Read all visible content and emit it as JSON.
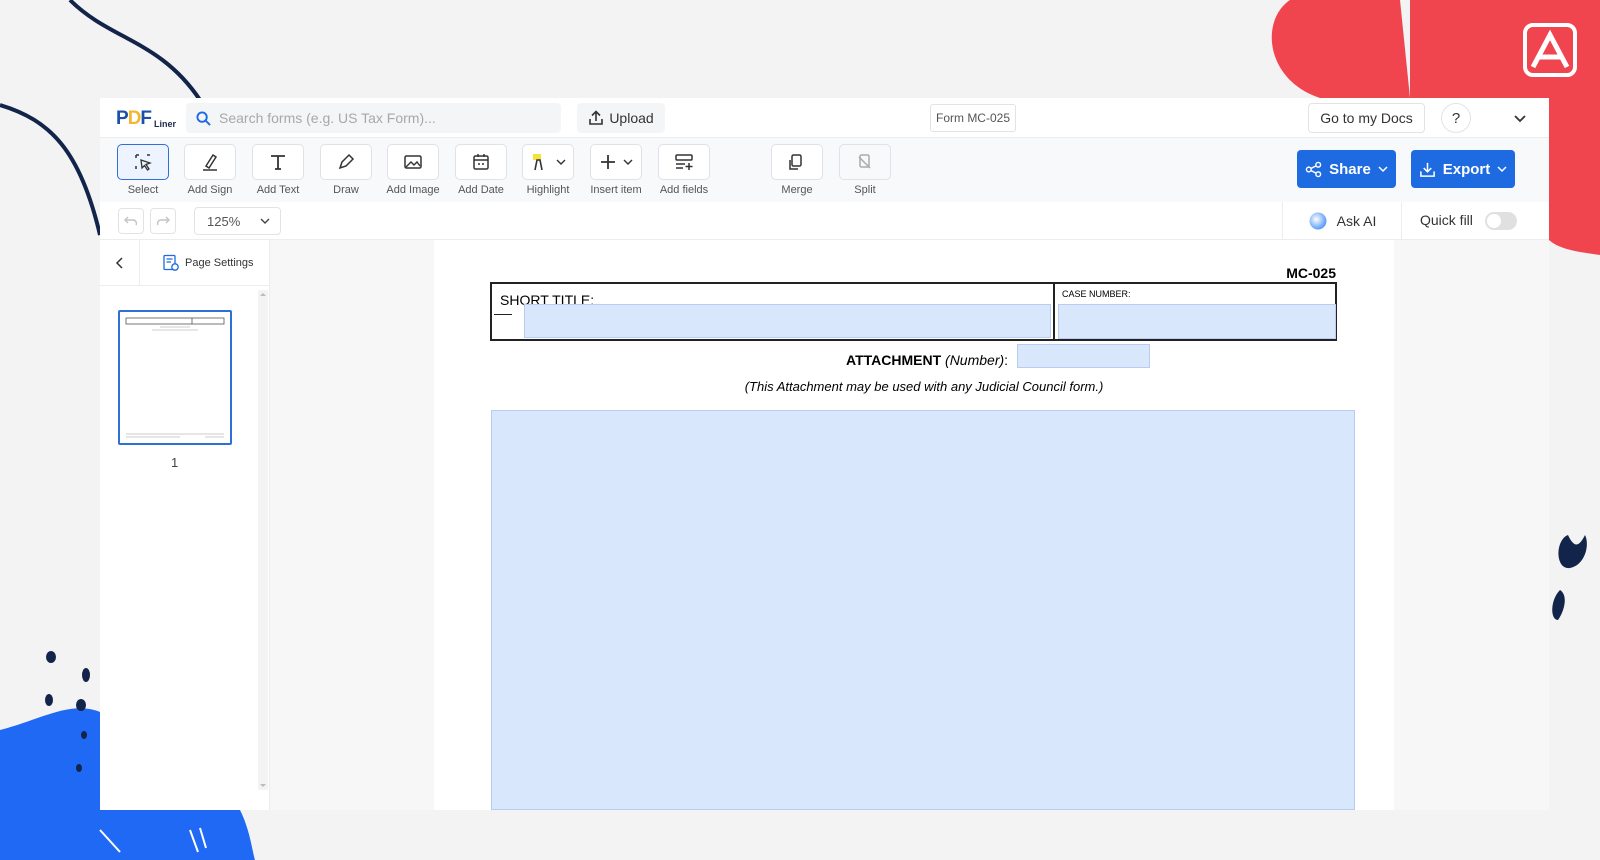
{
  "brand": {
    "logo_main": "PDF",
    "logo_sub": "Liner"
  },
  "topbar": {
    "search_placeholder": "Search forms (e.g. US Tax Form)...",
    "upload_label": "Upload",
    "doc_name": "Form MC-025",
    "go_to_docs": "Go to my Docs",
    "help_label": "?"
  },
  "toolbar": {
    "tools": [
      {
        "label": "Select",
        "icon": "select-cursor-icon"
      },
      {
        "label": "Add Sign",
        "icon": "sign-pen-icon"
      },
      {
        "label": "Add Text",
        "icon": "text-t-icon"
      },
      {
        "label": "Draw",
        "icon": "pen-draw-icon"
      },
      {
        "label": "Add Image",
        "icon": "image-icon"
      },
      {
        "label": "Add Date",
        "icon": "calendar-icon"
      },
      {
        "label": "Highlight",
        "icon": "highlighter-icon"
      },
      {
        "label": "Insert item",
        "icon": "plus-icon"
      },
      {
        "label": "Add fields",
        "icon": "add-fields-icon"
      },
      {
        "label": "Merge",
        "icon": "merge-icon"
      },
      {
        "label": "Split",
        "icon": "split-icon"
      }
    ],
    "share_label": "Share",
    "export_label": "Export"
  },
  "subbar": {
    "zoom": "125%",
    "ask_ai": "Ask AI",
    "quick_fill": "Quick fill",
    "quick_fill_on": false
  },
  "left_panel": {
    "page_settings": "Page Settings",
    "thumbnail_page": "1"
  },
  "document": {
    "form_id": "MC-025",
    "short_title_label": "SHORT TITLE:",
    "case_number_label": "CASE NUMBER:",
    "attachment_bold": "ATTACHMENT",
    "attachment_italic": "(Number)",
    "attachment_colon": ":",
    "note": "(This Attachment may be used with any Judicial Council form.)"
  },
  "colors": {
    "accent_blue": "#1e6ae0",
    "field_fill": "#d9e7fd",
    "deco_red": "#f0454f",
    "deco_navy": "#13244a"
  }
}
